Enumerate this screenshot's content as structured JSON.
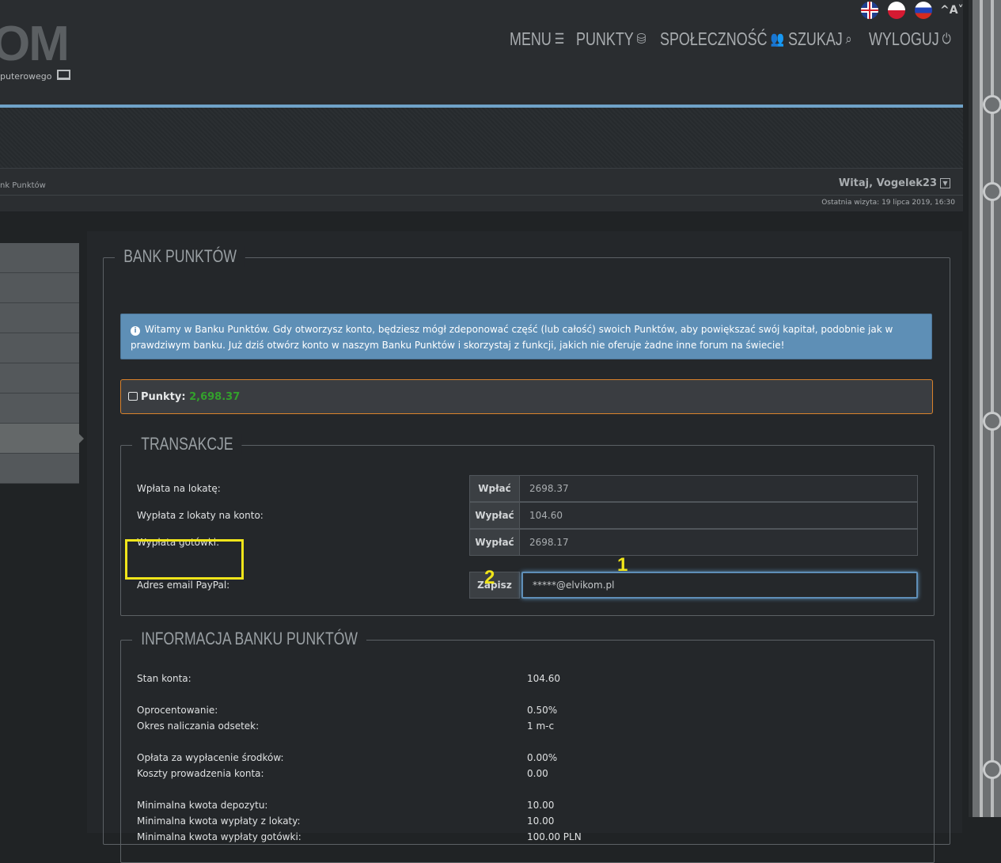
{
  "header": {
    "logo_text": "OM",
    "logo_sub": "puterowego",
    "font_toggle": "^A˅",
    "nav": [
      {
        "label": "MENU",
        "icon": "hamburger-icon"
      },
      {
        "label": "PUNKTY",
        "icon": "coins-icon"
      },
      {
        "label": "SPOŁECZNOŚĆ",
        "icon": "users-icon"
      },
      {
        "label": "SZUKAJ",
        "icon": "search-icon"
      },
      {
        "label": "WYLOGUJ",
        "icon": "power-icon"
      }
    ]
  },
  "breadcrumb": "nk Punktów",
  "user": {
    "welcome": "Witaj, Vogelek23",
    "last_visit": "Ostatnia wizyta: 19 lipca 2019, 16:30"
  },
  "bank": {
    "title": "BANK PUNKTÓW",
    "info_text": "Witamy w Banku Punktów. Gdy otworzysz konto, będziesz mógł zdeponować część (lub całość) swoich Punktów, aby powiększać swój kapitał, podobnie jak w prawdziwym banku. Już dziś otwórz konto w naszym Banku Punktów i skorzystaj z funkcji, jakich nie oferuje żadne inne forum na świecie!",
    "points_label": "Punkty:",
    "points_value": "2,698.37"
  },
  "transactions": {
    "title": "TRANSAKCJE",
    "rows": [
      {
        "label": "Wpłata na lokatę:",
        "button": "Wpłać",
        "value": "2698.37"
      },
      {
        "label": "Wypłata z lokaty na konto:",
        "button": "Wypłać",
        "value": "104.60"
      },
      {
        "label": "Wypłata gotówki:",
        "button": "Wypłać",
        "value": "2698.17"
      },
      {
        "label": "Adres email PayPal:",
        "button": "Zapisz",
        "value": "*****@elvikom.pl"
      }
    ]
  },
  "annotations": {
    "one": "1",
    "two": "2"
  },
  "bank_info": {
    "title": "INFORMACJA BANKU PUNKTÓW",
    "rows": [
      {
        "label": "Stan konta:",
        "value": "104.60"
      },
      {
        "label": "Oprocentowanie:",
        "value": "0.50%"
      },
      {
        "label": "Okres naliczania odsetek:",
        "value": "1 m-c"
      },
      {
        "label": "Opłata za wypłacenie środków:",
        "value": "0.00%"
      },
      {
        "label": "Koszty prowadzenia konta:",
        "value": "0.00"
      },
      {
        "label": "Minimalna kwota depozytu:",
        "value": "10.00"
      },
      {
        "label": "Minimalna kwota wypłaty z lokaty:",
        "value": "10.00"
      },
      {
        "label": "Minimalna kwota wypłaty gotówki:",
        "value": "100.00 PLN"
      }
    ]
  }
}
